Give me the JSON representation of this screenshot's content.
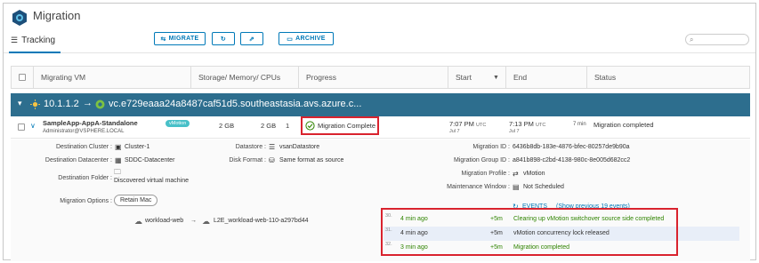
{
  "header": {
    "title": "Migration"
  },
  "tabs": {
    "tracking": "Tracking"
  },
  "toolbar": {
    "migrate": "MIGRATE",
    "archive": "ARCHIVE"
  },
  "columns": {
    "vm": "Migrating VM",
    "storage": "Storage/ Memory/ CPUs",
    "progress": "Progress",
    "start": "Start",
    "end": "End",
    "status": "Status"
  },
  "group": {
    "source": "10.1.1.2",
    "arrow": "→",
    "target": "vc.e729eaaa24a8487caf51d5.southeastasia.avs.azure.c..."
  },
  "row": {
    "vm_name": "SampleApp-AppA-Standalone",
    "badge": "vMotion",
    "owner": "Administrator@VSPHERE.LOCAL",
    "storage": "2 GB",
    "memory": "2 GB",
    "cpus": "1",
    "progress": "Migration Complete",
    "start_time": "7:07 PM",
    "start_tz": "UTC",
    "start_date": "Jul 7",
    "end_time": "7:13 PM",
    "end_tz": "UTC",
    "end_date": "Jul 7",
    "duration": "7 min",
    "status": "Migration completed"
  },
  "details": {
    "dest_cluster_label": "Destination Cluster :",
    "dest_cluster": "Cluster-1",
    "dest_dc_label": "Destination Datacenter :",
    "dest_dc": "SDDC-Datacenter",
    "dest_folder_label": "Destination Folder :",
    "dest_folder": "Discovered virtual machine",
    "options_label": "Migration Options :",
    "options_chip": "Retain Mac",
    "datastore_label": "Datastore :",
    "datastore": "vsanDatastore",
    "disk_format_label": "Disk Format :",
    "disk_format": "Same format as source",
    "migration_id_label": "Migration ID :",
    "migration_id": "6436b8db-183e-4876-bfec-80257de9b90a",
    "group_id_label": "Migration Group ID :",
    "group_id": "a841b898-c2bd-4138-980c-8e005d682cc2",
    "profile_label": "Migration Profile :",
    "profile": "vMotion",
    "maintenance_label": "Maintenance Window :",
    "maintenance": "Not Scheduled",
    "network_source": "workload-web",
    "network_arrow": "→",
    "network_target": "L2E_workload-web-110-a297bd44",
    "events_label": "EVENTS",
    "events_more": "(Show previous 19 events)"
  },
  "events": [
    {
      "num": "30.",
      "ago": "4 min ago",
      "delta": "+5m",
      "text": "Clearing up vMotion switchover source side completed",
      "color": "#2f8400"
    },
    {
      "num": "31.",
      "ago": "4 min ago",
      "delta": "+5m",
      "text": "vMotion concurrency lock released",
      "color": "#333333"
    },
    {
      "num": "32.",
      "ago": "3 min ago",
      "delta": "+5m",
      "text": "Migration completed",
      "color": "#2f8400"
    }
  ]
}
